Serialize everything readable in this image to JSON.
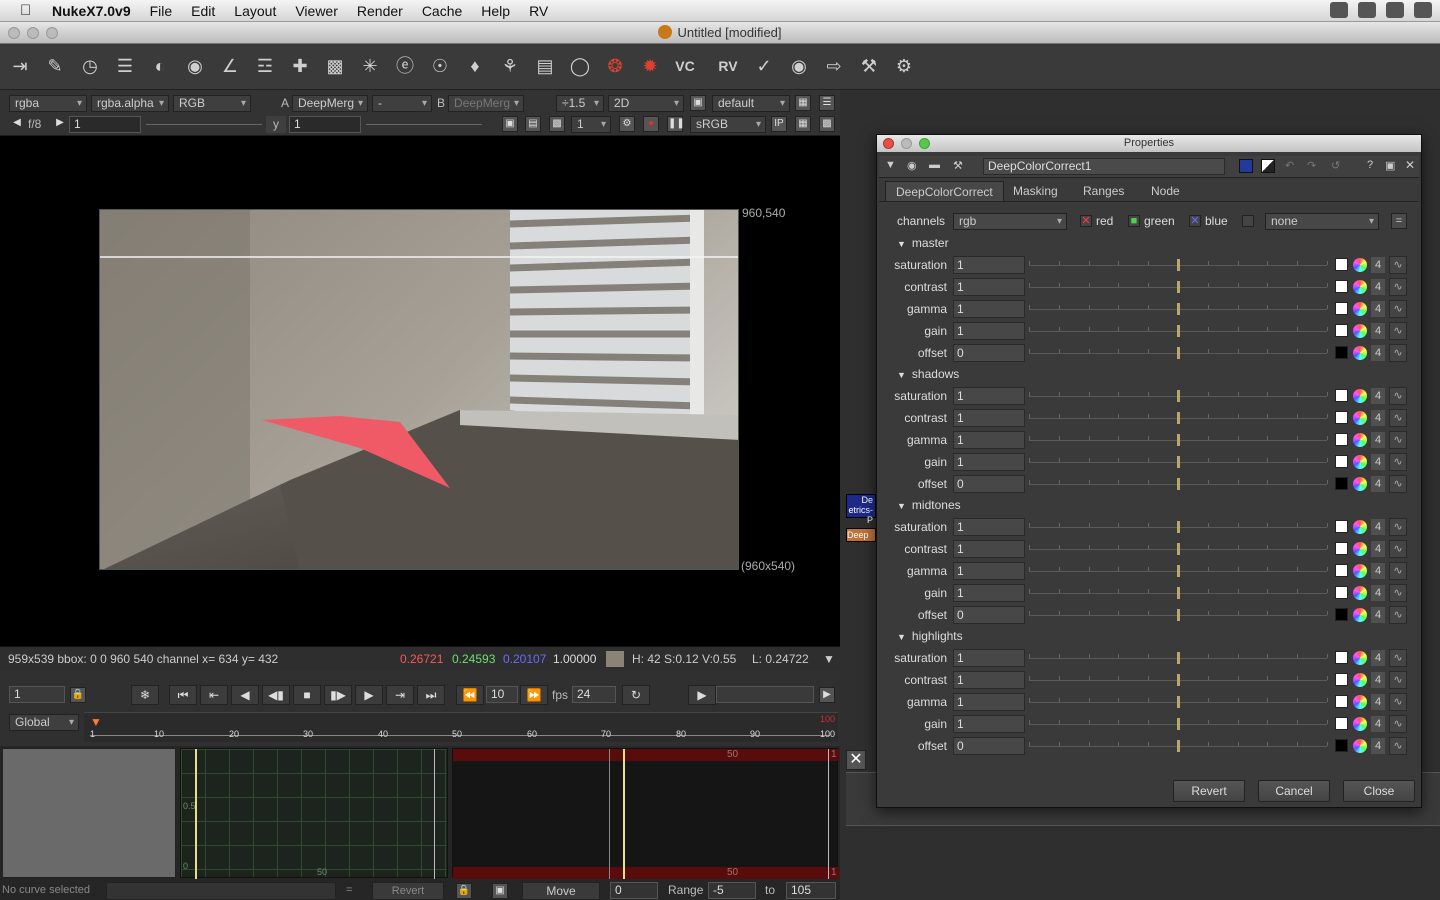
{
  "menubar": {
    "app": "NukeX7.0v9",
    "items": [
      "File",
      "Edit",
      "Layout",
      "Viewer",
      "Render",
      "Cache",
      "Help",
      "RV"
    ]
  },
  "window": {
    "title": "Untitled [modified]"
  },
  "toolbar": {
    "labels": {
      "vc": "VC",
      "rv": "RV"
    }
  },
  "viewer_controls": {
    "layer": "rgba",
    "alpha": "rgba.alpha",
    "display_channels": "RGB",
    "a_label": "A",
    "a_input": "DeepMerg",
    "compare_mode": "-",
    "b_label": "B",
    "b_input": "DeepMerg",
    "zoom": "÷1.5",
    "view_mode": "2D",
    "lut": "default",
    "fstop": "f/8",
    "gain_value": "1",
    "y_label": "y",
    "gamma_value": "1",
    "proxy": "1",
    "colorspace": "sRGB"
  },
  "viewer": {
    "top_right_label": "960,540",
    "bottom_right_label": "(960x540)"
  },
  "infobar": {
    "left": "959x539 bbox: 0 0 960 540 channel  x= 634 y= 432",
    "r": "0.26721",
    "g": "0.24593",
    "b": "0.20107",
    "a": "1.00000",
    "hsv": "H: 42 S:0.12 V:0.55",
    "lum": "L: 0.24722"
  },
  "timeline": {
    "frame": "1",
    "scope": "Global",
    "increment": "10",
    "fps_label": "fps",
    "fps": "24",
    "ticks": [
      "1",
      "10",
      "20",
      "30",
      "40",
      "50",
      "60",
      "70",
      "80",
      "90",
      "100"
    ],
    "end_marker": "100"
  },
  "curve_editor": {
    "status": "No curve selected",
    "eq": "=",
    "revert": "Revert",
    "move": "Move",
    "move_value": "0",
    "range_label": "Range",
    "range_from": "-5",
    "to_label": "to",
    "range_to": "105",
    "axis_labels": {
      "a": "0.5",
      "b": "0",
      "c": "50",
      "d": "50",
      "e": "50",
      "f": "1",
      "g": "1"
    }
  },
  "nodes": {
    "node1": "De",
    "node1_sub": "etrics-P",
    "node2": "Deep"
  },
  "properties": {
    "title": "Properties",
    "node_name": "DeepColorCorrect1",
    "tabs": [
      "DeepColorCorrect",
      "Masking",
      "Ranges",
      "Node"
    ],
    "channels_label": "channels",
    "channels_value": "rgb",
    "channel_toggles": [
      "red",
      "green",
      "blue"
    ],
    "mask_value": "none",
    "sections": [
      {
        "name": "master",
        "rows": [
          {
            "label": "saturation",
            "value": "1",
            "swatch": "#ffffff"
          },
          {
            "label": "contrast",
            "value": "1",
            "swatch": "#ffffff"
          },
          {
            "label": "gamma",
            "value": "1",
            "swatch": "#ffffff"
          },
          {
            "label": "gain",
            "value": "1",
            "swatch": "#ffffff"
          },
          {
            "label": "offset",
            "value": "0",
            "swatch": "#000000"
          }
        ]
      },
      {
        "name": "shadows",
        "rows": [
          {
            "label": "saturation",
            "value": "1",
            "swatch": "#ffffff"
          },
          {
            "label": "contrast",
            "value": "1",
            "swatch": "#ffffff"
          },
          {
            "label": "gamma",
            "value": "1",
            "swatch": "#ffffff"
          },
          {
            "label": "gain",
            "value": "1",
            "swatch": "#ffffff"
          },
          {
            "label": "offset",
            "value": "0",
            "swatch": "#000000"
          }
        ]
      },
      {
        "name": "midtones",
        "rows": [
          {
            "label": "saturation",
            "value": "1",
            "swatch": "#ffffff"
          },
          {
            "label": "contrast",
            "value": "1",
            "swatch": "#ffffff"
          },
          {
            "label": "gamma",
            "value": "1",
            "swatch": "#ffffff"
          },
          {
            "label": "gain",
            "value": "1",
            "swatch": "#ffffff"
          },
          {
            "label": "offset",
            "value": "0",
            "swatch": "#000000"
          }
        ]
      },
      {
        "name": "highlights",
        "rows": [
          {
            "label": "saturation",
            "value": "1",
            "swatch": "#ffffff"
          },
          {
            "label": "contrast",
            "value": "1",
            "swatch": "#ffffff"
          },
          {
            "label": "gamma",
            "value": "1",
            "swatch": "#ffffff"
          },
          {
            "label": "gain",
            "value": "1",
            "swatch": "#ffffff"
          },
          {
            "label": "offset",
            "value": "0",
            "swatch": "#000000"
          }
        ]
      }
    ],
    "four": "4",
    "buttons": {
      "revert": "Revert",
      "cancel": "Cancel",
      "close": "Close"
    }
  }
}
